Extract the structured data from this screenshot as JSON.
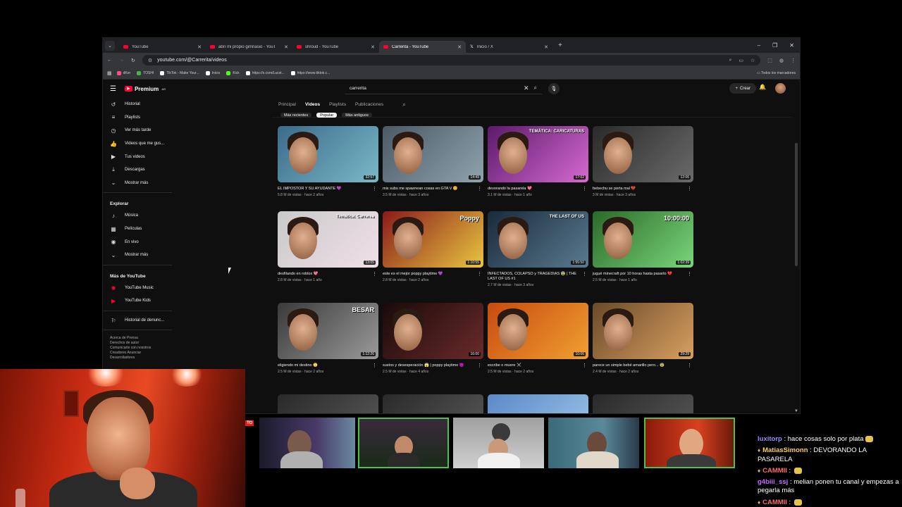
{
  "browser": {
    "tabs": [
      {
        "title": "YouTube",
        "active": false
      },
      {
        "title": "abrí mi propio gimnasio - YouT",
        "active": false
      },
      {
        "title": "shroud - YouTube",
        "active": false
      },
      {
        "title": "Carrerita - YouTube",
        "active": true
      },
      {
        "title": "Inicio / X",
        "active": false
      }
    ],
    "url": "youtube.com/@Carrerita/videos",
    "bookmarks": [
      {
        "label": "dKer",
        "color": "#ff4e88"
      },
      {
        "label": "TOSHI",
        "color": "#4caf50"
      },
      {
        "label": "TikTok - Make Your...",
        "color": "#ffffff"
      },
      {
        "label": "Inicio",
        "color": "#ffffff"
      },
      {
        "label": "Kick",
        "color": "#53fc18"
      },
      {
        "label": "https://x.com/Lucst...",
        "color": "#ffffff"
      },
      {
        "label": "https://www.tiktok.c...",
        "color": "#ffffff"
      }
    ],
    "bookmarks_right": "Todos los marcadores"
  },
  "yt": {
    "logo": "Premium",
    "logo_region": "AR",
    "search_value": "carrerita",
    "create_label": "Crear",
    "sidebar": {
      "items": [
        {
          "label": "Historial",
          "icon": "history-icon",
          "glyph": "↺"
        },
        {
          "label": "Playlists",
          "icon": "playlists-icon",
          "glyph": "≡"
        },
        {
          "label": "Ver más tarde",
          "icon": "clock-icon",
          "glyph": "◷"
        },
        {
          "label": "Videos que me gus...",
          "icon": "thumb-up-icon",
          "glyph": "👍"
        },
        {
          "label": "Tus videos",
          "icon": "your-videos-icon",
          "glyph": "▶"
        },
        {
          "label": "Descargas",
          "icon": "download-icon",
          "glyph": "⤓"
        },
        {
          "label": "Mostrar más",
          "icon": "chevron-down-icon",
          "glyph": "⌄"
        }
      ],
      "explore_heading": "Explorar",
      "explore": [
        {
          "label": "Música",
          "icon": "music-icon",
          "glyph": "♪"
        },
        {
          "label": "Películas",
          "icon": "film-icon",
          "glyph": "▦"
        },
        {
          "label": "En vivo",
          "icon": "live-icon",
          "glyph": "◉"
        },
        {
          "label": "Mostrar más",
          "icon": "chevron-down-icon",
          "glyph": "⌄"
        }
      ],
      "more_heading": "Más de YouTube",
      "more": [
        {
          "label": "YouTube Music",
          "icon": "youtube-music-icon",
          "glyph": "◉"
        },
        {
          "label": "YouTube Kids",
          "icon": "youtube-kids-icon",
          "glyph": "▶"
        }
      ],
      "report_history": "Historial de denunc...",
      "footer": [
        "Acerca de  Prensa",
        "Derechos de autor",
        "Comunicarte con nosotros",
        "Creadores  Anunciar",
        "Desarrolladores"
      ]
    },
    "channel_tabs": [
      "Principal",
      "Videos",
      "Playlists",
      "Publicaciones"
    ],
    "active_tab": "Videos",
    "chips": [
      "Más recientes",
      "Popular",
      "Más antiguos"
    ],
    "active_chip": "Popular",
    "videos": [
      {
        "title": "EL IMPOSTOR Y SU AYUDANTE 💜",
        "meta": "5.8 M de vistas · hace 2 años",
        "duration": "32:57",
        "bg": [
          "#3b6b8a",
          "#7ab8c8"
        ]
      },
      {
        "title": "mis subs me spawnean cosas en GTA V 😊",
        "meta": "3.5 M de vistas · hace 3 años",
        "duration": "14:49",
        "bg": [
          "#4a5a66",
          "#8fa3ad"
        ]
      },
      {
        "title": "devorando la pasarela 💖",
        "meta": "3.1 M de vistas · hace 1 año",
        "duration": "17:02",
        "bg": [
          "#5a1a6a",
          "#d66ad0"
        ],
        "overlay": "TEMÁTICA: CARICATURAS"
      },
      {
        "title": "bebechu se porta mal 💔",
        "meta": "3 M de vistas · hace 3 años",
        "duration": "12:06",
        "bg": [
          "#2a2a2a",
          "#6a6a6a"
        ]
      },
      {
        "title": "desfilando en roblox 💖",
        "meta": "2.8 M de vistas · hace 1 año",
        "duration": "13:05",
        "bg": [
          "#c9c9c9",
          "#f0e0e8"
        ],
        "overlay": "Temática: Carrerea"
      },
      {
        "title": "este es el mejor poppy playtime 💜",
        "meta": "2.8 M de vistas · hace 2 años",
        "duration": "1:10:55",
        "bg": [
          "#8a1a1a",
          "#e8c640"
        ],
        "overlay": "Poppy"
      },
      {
        "title": "INFECTADOS, COLAPSO y TRAGEDIAS 😰 | THE LAST OF US #1",
        "meta": "2.7 M de vistas · hace 3 años",
        "duration": "1:55:50",
        "bg": [
          "#1a2a3a",
          "#5a7a90"
        ],
        "overlay": "THE LAST OF US"
      },
      {
        "title": "jugué minecraft por 10 horas hasta pasarlo 💔",
        "meta": "2.5 M de vistas · hace 1 año",
        "duration": "1:02:39",
        "bg": [
          "#2a6a2a",
          "#7ad67a"
        ],
        "overlay": "10:00:00"
      },
      {
        "title": "eligiendo mi destino 😳",
        "meta": "2.5 M de vistas · hace 2 años",
        "duration": "1:12:26",
        "bg": [
          "#3a3a3a",
          "#9a9a9a"
        ],
        "overlay": "BESAR"
      },
      {
        "title": "sustos y desesperación 😱 | poppy playtime 😈",
        "meta": "2.5 M de vistas · hace 4 años",
        "duration": "16:00",
        "bg": [
          "#1a0a0a",
          "#6a2a2a"
        ]
      },
      {
        "title": "escribe o muere ⚔️",
        "meta": "2.5 M de vistas · hace 2 años",
        "duration": "10:06",
        "bg": [
          "#c84a10",
          "#f0a030"
        ]
      },
      {
        "title": "parece un simple bebé amarillo pero... 😨",
        "meta": "2.4 M de vistas · hace 2 años",
        "duration": "29:29",
        "bg": [
          "#6a4a2a",
          "#d8a060"
        ]
      }
    ]
  },
  "chat": [
    {
      "user": "luxitorp",
      "color": "#9b8cff",
      "text": "hace cosas solo por plata",
      "badge": false,
      "emote": true
    },
    {
      "user": "MatiasSimonn",
      "color": "#ffd24a",
      "text": "DEVORANDO LA PASARELA",
      "badge": true,
      "emote": false
    },
    {
      "user": "CAMMII",
      "color": "#ff6a6a",
      "text": "",
      "badge": true,
      "emote": true
    },
    {
      "user": "g4biii_ssj",
      "color": "#c46aff",
      "text": "melian ponen tu canal y empezas a pegarla más",
      "badge": false,
      "emote": false
    },
    {
      "user": "CAMMII",
      "color": "#ff6a6a",
      "text": "",
      "badge": true,
      "emote": true
    }
  ]
}
